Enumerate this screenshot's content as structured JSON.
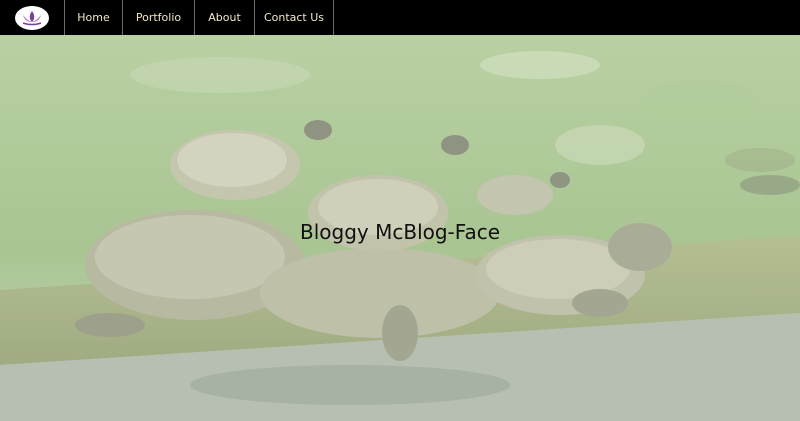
{
  "nav": {
    "logo_icon": "lotus-icon",
    "items": [
      {
        "label": "Home"
      },
      {
        "label": "Portfolio"
      },
      {
        "label": "About"
      },
      {
        "label": "Contact Us"
      }
    ]
  },
  "hero": {
    "title": "Bloggy McBlog-Face",
    "image": "turtles-photo"
  },
  "colors": {
    "nav_bg": "#000000",
    "nav_text": "#f2e8c5",
    "logo_accent": "#7b3fa0"
  }
}
